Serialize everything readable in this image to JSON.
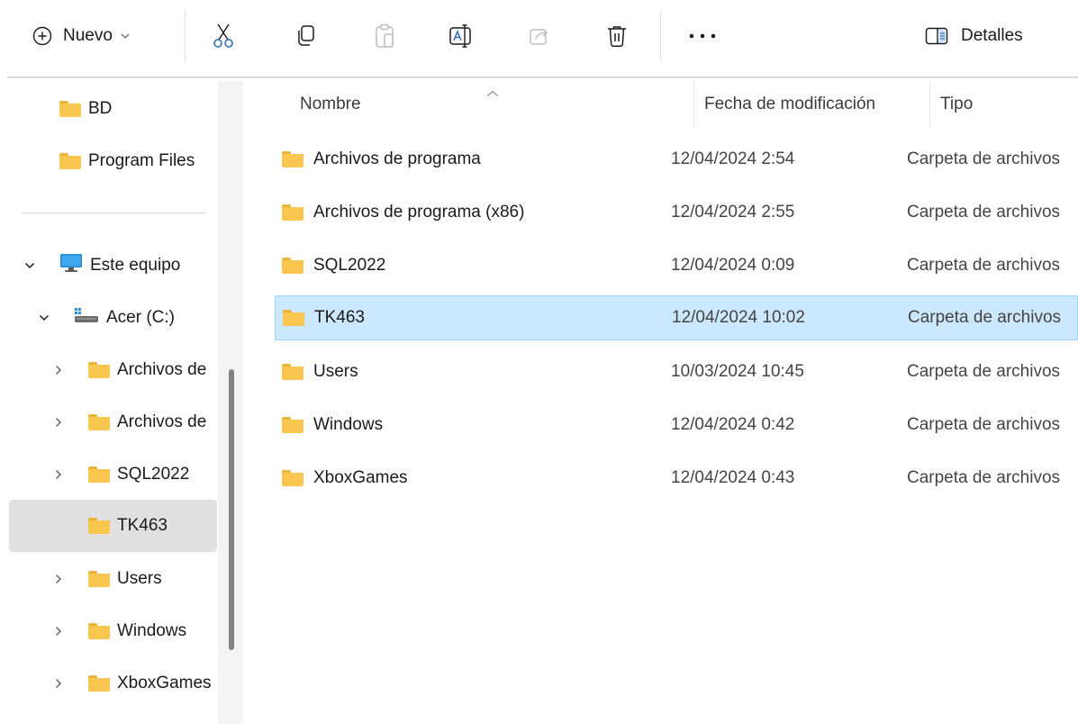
{
  "toolbar": {
    "new_label": "Nuevo",
    "details_label": "Detalles",
    "icons": [
      "add-circle-icon",
      "chevron-down-icon",
      "cut-icon",
      "copy-icon",
      "paste-icon",
      "rename-icon",
      "share-icon",
      "delete-icon",
      "more-icon",
      "details-pane-icon"
    ]
  },
  "sidebar": {
    "pinned": [
      {
        "label": "BD"
      },
      {
        "label": "Program Files"
      }
    ],
    "this_pc": {
      "label": "Este equipo"
    },
    "drive": {
      "label": "Acer (C:)"
    },
    "folders": [
      {
        "label": "Archivos de"
      },
      {
        "label": "Archivos de"
      },
      {
        "label": "SQL2022"
      },
      {
        "label": "TK463"
      },
      {
        "label": "Users"
      },
      {
        "label": "Windows"
      },
      {
        "label": "XboxGames"
      }
    ]
  },
  "columns": {
    "name": "Nombre",
    "date": "Fecha de modificación",
    "type": "Tipo"
  },
  "rows": [
    {
      "name": "Archivos de programa",
      "date": "12/04/2024 2:54",
      "type": "Carpeta de archivos"
    },
    {
      "name": "Archivos de programa (x86)",
      "date": "12/04/2024 2:55",
      "type": "Carpeta de archivos"
    },
    {
      "name": "SQL2022",
      "date": "12/04/2024 0:09",
      "type": "Carpeta de archivos"
    },
    {
      "name": "TK463",
      "date": "12/04/2024 10:02",
      "type": "Carpeta de archivos"
    },
    {
      "name": "Users",
      "date": "10/03/2024 10:45",
      "type": "Carpeta de archivos"
    },
    {
      "name": "Windows",
      "date": "12/04/2024 0:42",
      "type": "Carpeta de archivos"
    },
    {
      "name": "XboxGames",
      "date": "12/04/2024 0:43",
      "type": "Carpeta de archivos"
    }
  ],
  "selected_row": "TK463",
  "colors": {
    "selection": "#cce8ff",
    "selection_border": "#99d1ff",
    "folder": "#f9c74f",
    "sidebar_selected": "#e0e0e0"
  }
}
